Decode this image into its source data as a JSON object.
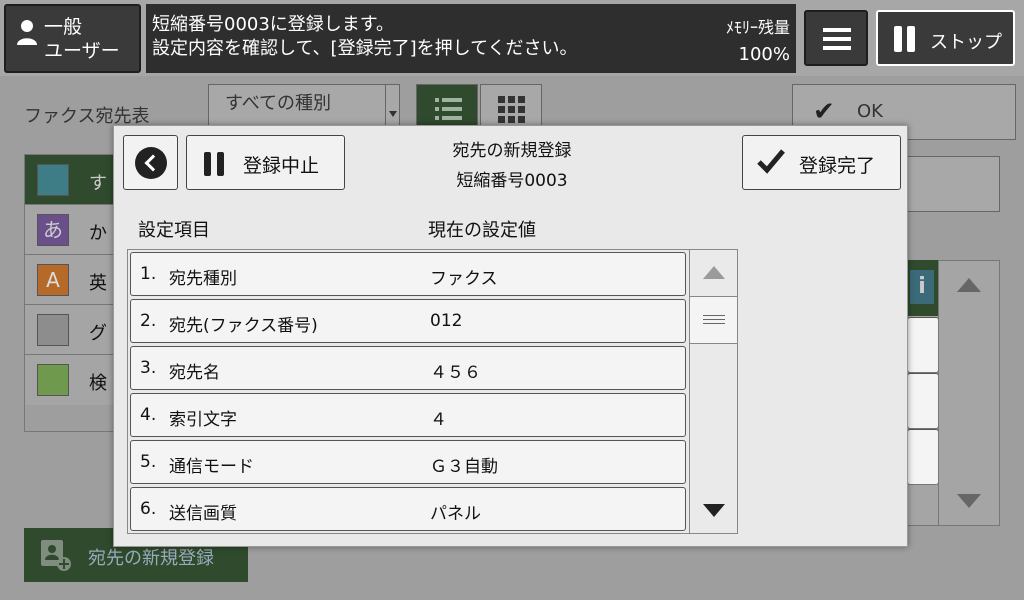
{
  "topbar": {
    "user_line1": "一般",
    "user_line2": "ユーザー",
    "message_line1": "短縮番号0003に登録します。",
    "message_line2": "設定内容を確認して、[登録完了]を押してください。",
    "memory_label": "ﾒﾓﾘｰ残量",
    "memory_value": "100%",
    "stop_label": "ストップ"
  },
  "background": {
    "fax_book_label": "ファクス宛先表",
    "type_select_value": "すべての種別",
    "ok_label": "OK",
    "categories": [
      {
        "icon": "all-icon",
        "label": "す"
      },
      {
        "icon": "kana-icon",
        "glyph": "あ",
        "label": "か"
      },
      {
        "icon": "alpha-icon",
        "glyph": "A",
        "label": "英"
      },
      {
        "icon": "group-icon",
        "label": "グ"
      },
      {
        "icon": "search-icon",
        "label": "検"
      }
    ],
    "new_entry_label": "宛先の新規登録"
  },
  "modal": {
    "back_icon": "chevron-left-icon",
    "cancel_label": "登録中止",
    "title": "宛先の新規登録",
    "subtitle": "短縮番号0003",
    "done_label": "登録完了",
    "col_item": "設定項目",
    "col_value": "現在の設定値",
    "rows": [
      {
        "num": "1.",
        "label": "宛先種別",
        "value": "ファクス"
      },
      {
        "num": "2.",
        "label": "宛先(ファクス番号)",
        "value": "012"
      },
      {
        "num": "3.",
        "label": "宛先名",
        "value": "４５６"
      },
      {
        "num": "4.",
        "label": "索引文字",
        "value": "４"
      },
      {
        "num": "5.",
        "label": "通信モード",
        "value": "Ｇ３自動"
      },
      {
        "num": "6.",
        "label": "送信画質",
        "value": "パネル"
      }
    ]
  },
  "colors": {
    "accent_green": "#2f4a2c",
    "dark_button": "#3a3a3a",
    "message_bg": "#2e2e2e"
  }
}
